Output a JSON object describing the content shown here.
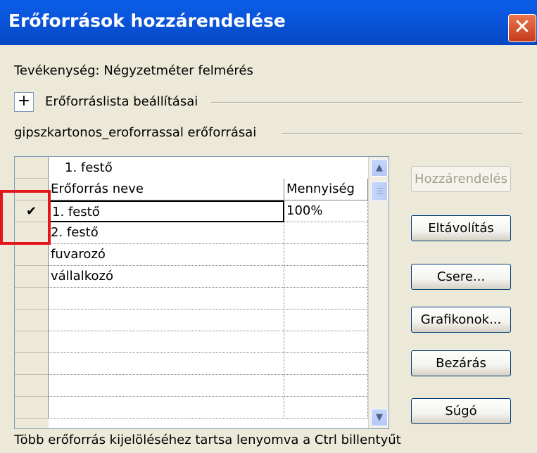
{
  "window": {
    "title": "Erőforrások hozzárendelése",
    "close_glyph": "✕"
  },
  "task_label": "Tevékenység: Négyzetméter felmérés",
  "options_section": {
    "toggle": "+",
    "label": "Erőforráslista beállításai"
  },
  "resources_section_label": "gipszkartonos_eroforrassal erőforrásai",
  "grid": {
    "edit_value": "1. festő",
    "columns": [
      "Erőforrás neve",
      "Mennyiség"
    ],
    "rows": [
      {
        "mark": "✔",
        "name": "1. festő",
        "qty": "100%"
      },
      {
        "mark": "",
        "name": "2. festő",
        "qty": ""
      },
      {
        "mark": "",
        "name": "fuvarozó",
        "qty": ""
      },
      {
        "mark": "",
        "name": "vállalkozó",
        "qty": ""
      },
      {
        "mark": "",
        "name": "",
        "qty": ""
      },
      {
        "mark": "",
        "name": "",
        "qty": ""
      },
      {
        "mark": "",
        "name": "",
        "qty": ""
      },
      {
        "mark": "",
        "name": "",
        "qty": ""
      },
      {
        "mark": "",
        "name": "",
        "qty": ""
      },
      {
        "mark": "",
        "name": "",
        "qty": ""
      }
    ],
    "scroll_up": "▲",
    "scroll_down": "▼"
  },
  "buttons": {
    "assign": "Hozzárendelés",
    "remove": "Eltávolítás",
    "replace": "Csere...",
    "graphs": "Grafikonok...",
    "close": "Bezárás",
    "help": "Súgó"
  },
  "footer_hint": "Több erőforrás kijelöléséhez tartsa lenyomva a Ctrl billentyűt",
  "colors": {
    "titlebar": "#0a53d8",
    "dialog_bg": "#ece9d8",
    "highlight_box": "#e3161c"
  }
}
